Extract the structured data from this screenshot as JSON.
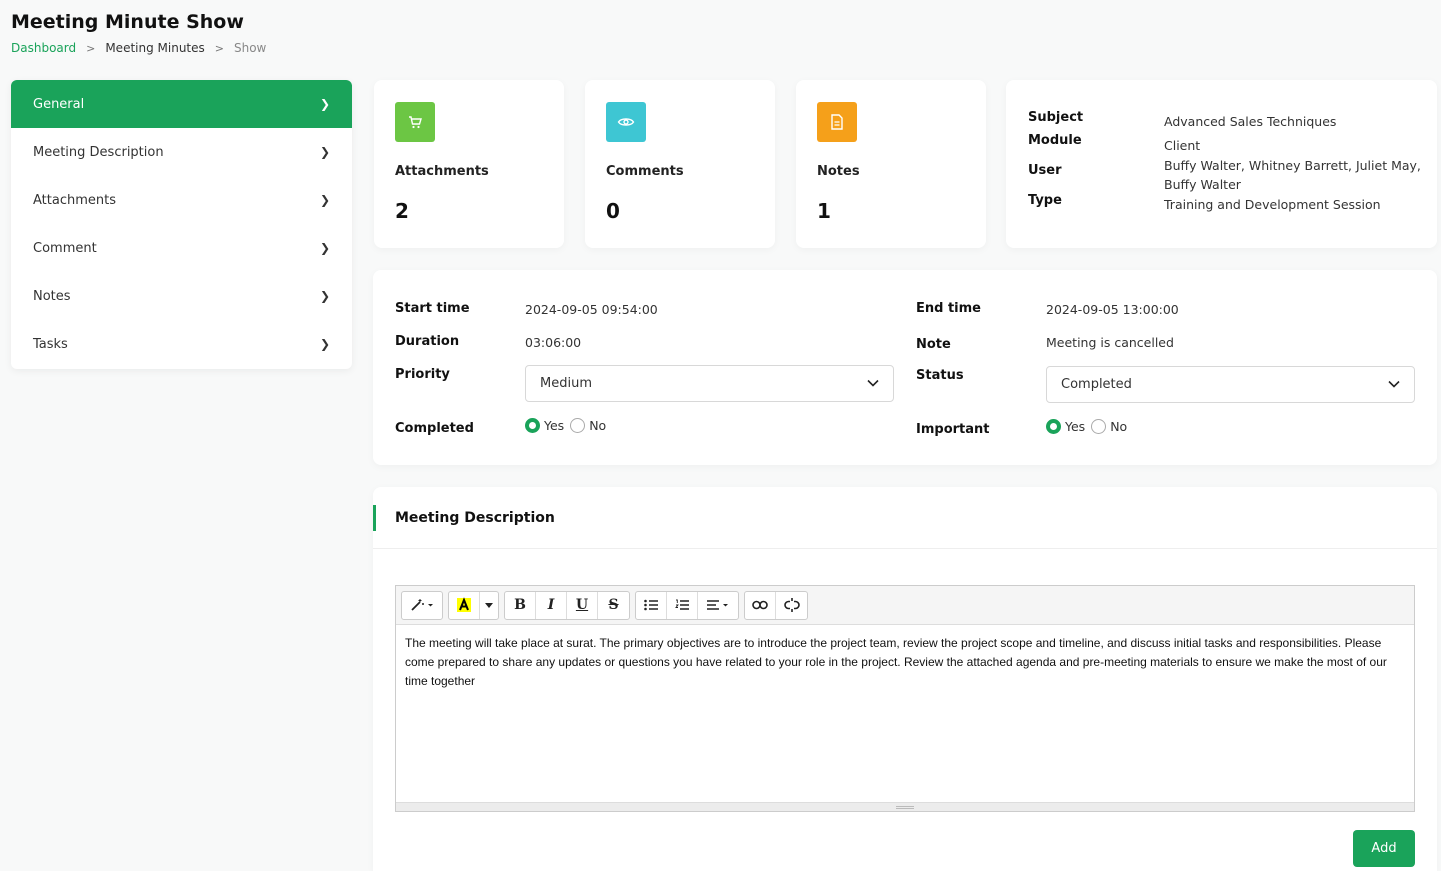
{
  "page": {
    "title": "Meeting Minute Show"
  },
  "breadcrumb": {
    "items": [
      "Dashboard",
      "Meeting Minutes",
      "Show"
    ]
  },
  "sidebar": {
    "items": [
      {
        "label": "General",
        "active": true
      },
      {
        "label": "Meeting Description"
      },
      {
        "label": "Attachments"
      },
      {
        "label": "Comment"
      },
      {
        "label": "Notes"
      },
      {
        "label": "Tasks"
      }
    ]
  },
  "stats": [
    {
      "label": "Attachments",
      "value": "2",
      "icon": "cart-icon",
      "color": "#6cc644"
    },
    {
      "label": "Comments",
      "value": "0",
      "icon": "eye-icon",
      "color": "#3ec6d3"
    },
    {
      "label": "Notes",
      "value": "1",
      "icon": "document-icon",
      "color": "#f5a01a"
    }
  ],
  "info": {
    "subject_label": "Subject",
    "subject": "Advanced Sales Techniques",
    "module_label": "Module",
    "module": "Client",
    "user_label": "User",
    "user": "Buffy Walter, Whitney Barrett, Juliet May, Buffy Walter",
    "type_label": "Type",
    "type": "Training and Development Session"
  },
  "details": {
    "start_label": "Start time",
    "start": "2024-09-05 09:54:00",
    "end_label": "End time",
    "end": "2024-09-05 13:00:00",
    "duration_label": "Duration",
    "duration": "03:06:00",
    "note_label": "Note",
    "note": "Meeting is cancelled",
    "priority_label": "Priority",
    "priority": "Medium",
    "status_label": "Status",
    "status": "Completed",
    "completed_label": "Completed",
    "important_label": "Important",
    "yes": "Yes",
    "no": "No"
  },
  "description": {
    "heading": "Meeting Description",
    "text": "The meeting will take place at surat. The primary objectives are to introduce the project team, review the project scope and timeline, and discuss initial tasks and responsibilities. Please come prepared to share any updates or questions you have related to your role in the project. Review the attached agenda and pre-meeting materials to ensure we make the most of our time together",
    "add_label": "Add"
  },
  "colors": {
    "accent": "#1aa35a"
  }
}
